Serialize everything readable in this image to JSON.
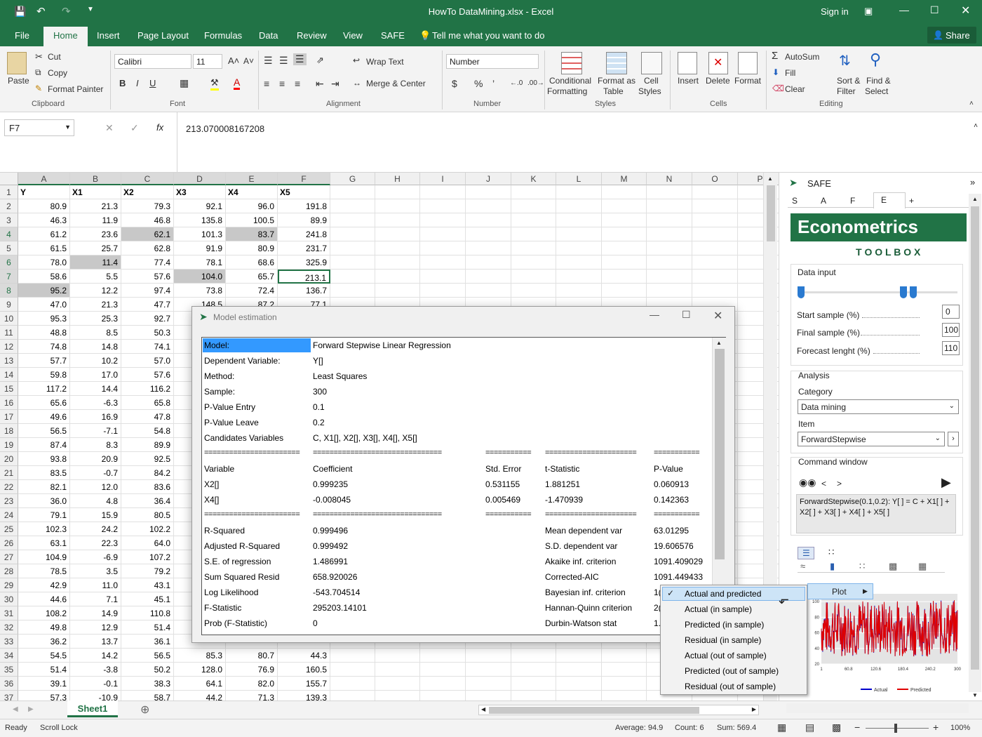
{
  "window": {
    "title": "HowTo DataMining.xlsx - Excel",
    "signin": "Sign in",
    "share": "Share"
  },
  "tabs": [
    "File",
    "Home",
    "Insert",
    "Page Layout",
    "Formulas",
    "Data",
    "Review",
    "View",
    "SAFE"
  ],
  "tellme": "Tell me what you want to do",
  "ribbon": {
    "clipboard": {
      "paste": "Paste",
      "cut": "Cut",
      "copy": "Copy",
      "format_painter": "Format Painter",
      "group": "Clipboard"
    },
    "font": {
      "name": "Calibri",
      "size": "11",
      "group": "Font"
    },
    "alignment": {
      "wrap": "Wrap Text",
      "merge": "Merge & Center",
      "group": "Alignment"
    },
    "number": {
      "format": "Number",
      "group": "Number"
    },
    "styles": {
      "cond1": "Conditional",
      "cond2": "Formatting",
      "fmt1": "Format as",
      "fmt2": "Table",
      "cell1": "Cell",
      "cell2": "Styles",
      "group": "Styles"
    },
    "cells": {
      "insert": "Insert",
      "delete": "Delete",
      "format": "Format",
      "group": "Cells"
    },
    "editing": {
      "autosum": "AutoSum",
      "fill": "Fill",
      "clear": "Clear",
      "sort1": "Sort &",
      "sort2": "Filter",
      "find1": "Find &",
      "find2": "Select",
      "group": "Editing"
    }
  },
  "formula": {
    "namebox": "F7",
    "fx": "fx",
    "value": "213.070008167208"
  },
  "columns": [
    "A",
    "B",
    "C",
    "D",
    "E",
    "F",
    "G",
    "H",
    "I",
    "J",
    "K",
    "L",
    "M",
    "N",
    "O",
    "P"
  ],
  "header_row": [
    "Y",
    "X1",
    "X2",
    "X3",
    "X4",
    "X5"
  ],
  "rows": [
    [
      "80.9",
      "21.3",
      "79.3",
      "92.1",
      "96.0",
      "191.8"
    ],
    [
      "46.3",
      "11.9",
      "46.8",
      "135.8",
      "100.5",
      "89.9"
    ],
    [
      "61.2",
      "23.6",
      "62.1",
      "101.3",
      "83.7",
      "241.8"
    ],
    [
      "61.5",
      "25.7",
      "62.8",
      "91.9",
      "80.9",
      "231.7"
    ],
    [
      "78.0",
      "11.4",
      "77.4",
      "78.1",
      "68.6",
      "325.9"
    ],
    [
      "58.6",
      "5.5",
      "57.6",
      "104.0",
      "65.7",
      "213.1"
    ],
    [
      "95.2",
      "12.2",
      "97.4",
      "73.8",
      "72.4",
      "136.7"
    ],
    [
      "47.0",
      "21.3",
      "47.7",
      "148.5",
      "87.2",
      "77.1"
    ],
    [
      "95.3",
      "25.3",
      "92.7",
      "",
      "",
      ""
    ],
    [
      "48.8",
      "8.5",
      "50.3",
      "",
      "",
      ""
    ],
    [
      "74.8",
      "14.8",
      "74.1",
      "",
      "",
      ""
    ],
    [
      "57.7",
      "10.2",
      "57.0",
      "",
      "",
      ""
    ],
    [
      "59.8",
      "17.0",
      "57.6",
      "",
      "",
      ""
    ],
    [
      "117.2",
      "14.4",
      "116.2",
      "",
      "",
      ""
    ],
    [
      "65.6",
      "-6.3",
      "65.8",
      "",
      "",
      ""
    ],
    [
      "49.6",
      "16.9",
      "47.8",
      "",
      "",
      ""
    ],
    [
      "56.5",
      "-7.1",
      "54.8",
      "",
      "",
      ""
    ],
    [
      "87.4",
      "8.3",
      "89.9",
      "",
      "",
      ""
    ],
    [
      "93.8",
      "20.9",
      "92.5",
      "",
      "",
      ""
    ],
    [
      "83.5",
      "-0.7",
      "84.2",
      "",
      "",
      ""
    ],
    [
      "82.1",
      "12.0",
      "83.6",
      "",
      "",
      ""
    ],
    [
      "36.0",
      "4.8",
      "36.4",
      "",
      "",
      ""
    ],
    [
      "79.1",
      "15.9",
      "80.5",
      "",
      "",
      ""
    ],
    [
      "102.3",
      "24.2",
      "102.2",
      "",
      "",
      ""
    ],
    [
      "63.1",
      "22.3",
      "64.0",
      "",
      "",
      ""
    ],
    [
      "104.9",
      "-6.9",
      "107.2",
      "",
      "",
      ""
    ],
    [
      "78.5",
      "3.5",
      "79.2",
      "",
      "",
      ""
    ],
    [
      "42.9",
      "11.0",
      "43.1",
      "",
      "",
      ""
    ],
    [
      "44.6",
      "7.1",
      "45.1",
      "",
      "",
      ""
    ],
    [
      "108.2",
      "14.9",
      "110.8",
      "",
      "",
      ""
    ],
    [
      "49.8",
      "12.9",
      "51.4",
      "",
      "",
      ""
    ],
    [
      "36.2",
      "13.7",
      "36.1",
      "",
      "",
      ""
    ],
    [
      "54.5",
      "14.2",
      "56.5",
      "85.3",
      "80.7",
      "44.3"
    ],
    [
      "51.4",
      "-3.8",
      "50.2",
      "128.0",
      "76.9",
      "160.5"
    ],
    [
      "39.1",
      "-0.1",
      "38.3",
      "64.1",
      "82.0",
      "155.7"
    ],
    [
      "57.3",
      "-10.9",
      "58.7",
      "44.2",
      "71.3",
      "139.3"
    ]
  ],
  "dialog": {
    "title": "Model estimation",
    "info": [
      [
        "Model:",
        "Forward Stepwise Linear Regression"
      ],
      [
        "Dependent Variable:",
        "Y[]"
      ],
      [
        "Method:",
        "Least Squares"
      ],
      [
        "Sample:",
        "300"
      ],
      [
        "P-Value Entry",
        "0.1"
      ],
      [
        "P-Value Leave",
        "0.2"
      ],
      [
        "Candidates Variables",
        "C, X1[], X2[], X3[], X4[], X5[]"
      ]
    ],
    "sep": [
      "=======================",
      "===============================",
      "===========",
      "======================",
      "==========="
    ],
    "coef_head": [
      "Variable",
      "Coefficient",
      "Std. Error",
      "t-Statistic",
      "P-Value"
    ],
    "coef": [
      [
        "X2[]",
        "0.999235",
        "0.531155",
        "1.881251",
        "0.060913"
      ],
      [
        "X4[]",
        "-0.008045",
        "0.005469",
        "-1.470939",
        "0.142363"
      ]
    ],
    "stats_left": [
      [
        "R-Squared",
        "0.999496"
      ],
      [
        "Adjusted R-Squared",
        "0.999492"
      ],
      [
        "S.E. of regression",
        "1.486991"
      ],
      [
        "Sum Squared Resid",
        "658.920026"
      ],
      [
        "Log Likelihood",
        "-543.704514"
      ],
      [
        "F-Statistic",
        "295203.14101"
      ],
      [
        "Prob (F-Statistic)",
        "0"
      ]
    ],
    "stats_right": [
      [
        "Mean dependent var",
        "63.01295"
      ],
      [
        "S.D. dependent var",
        "19.606576"
      ],
      [
        "Akaike inf. criterion",
        "1091.409029"
      ],
      [
        "Corrected-AIC",
        "1091.449433"
      ],
      [
        "Bayesian inf. criterion",
        "1("
      ],
      [
        "Hannan-Quinn criterion",
        "2("
      ],
      [
        "Durbin-Watson stat",
        "1."
      ]
    ]
  },
  "safe": {
    "title": "SAFE",
    "tabs": [
      "S",
      "A",
      "F",
      "E",
      "+"
    ],
    "brand": "Econometrics",
    "brand_sub": "T O O L B O X",
    "data_input": "Data input",
    "start": {
      "label": "Start sample (%)",
      "value": "0"
    },
    "final": {
      "label": "Final sample (%)",
      "value": "100"
    },
    "forecast": {
      "label": "Forecast lenght (%)",
      "value": "110"
    },
    "analysis": "Analysis",
    "category_label": "Category",
    "category": "Data mining",
    "item_label": "Item",
    "item": "ForwardStepwise",
    "command_label": "Command window",
    "command": "ForwardStepwise(0.1,0.2): Y[ ] = C + X1[ ] + X2[ ] + X3[ ] + X4[ ] + X5[ ]",
    "legend": [
      "Actual",
      "Predicted"
    ]
  },
  "context_menu": {
    "items": [
      "Actual and predicted",
      "Actual (in sample)",
      "Predicted (in sample)",
      "Residual (in sample)",
      "Actual (out of sample)",
      "Predicted (out of sample)",
      "Residual (out of sample)"
    ],
    "plot": "Plot"
  },
  "chart_data": {
    "type": "line",
    "x_ticks": [
      "1",
      "60.8",
      "120.6",
      "180.4",
      "240.2",
      "300"
    ],
    "y_ticks": [
      "20",
      "40",
      "60",
      "80",
      "100"
    ],
    "ylim": [
      20,
      110
    ],
    "series": [
      {
        "name": "Actual",
        "color": "#0000cc"
      },
      {
        "name": "Predicted",
        "color": "#e00000"
      }
    ]
  },
  "sheet_tab": "Sheet1",
  "status": {
    "ready": "Ready",
    "scroll": "Scroll Lock",
    "average": "Average: 94.9",
    "count": "Count: 6",
    "sum": "Sum: 569.4",
    "zoom": "100%"
  }
}
